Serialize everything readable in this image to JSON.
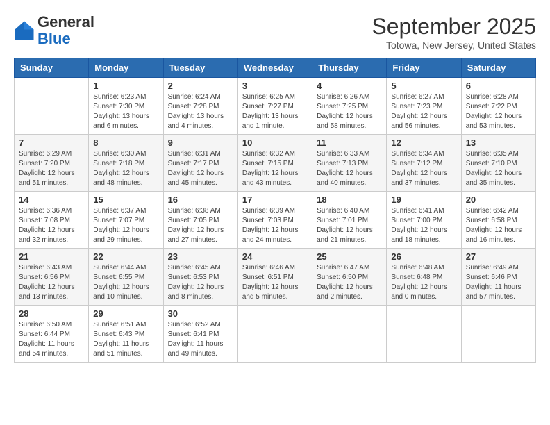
{
  "logo": {
    "general": "General",
    "blue": "Blue"
  },
  "header": {
    "month": "September 2025",
    "location": "Totowa, New Jersey, United States"
  },
  "weekdays": [
    "Sunday",
    "Monday",
    "Tuesday",
    "Wednesday",
    "Thursday",
    "Friday",
    "Saturday"
  ],
  "weeks": [
    [
      {
        "day": "",
        "sunrise": "",
        "sunset": "",
        "daylight": ""
      },
      {
        "day": "1",
        "sunrise": "Sunrise: 6:23 AM",
        "sunset": "Sunset: 7:30 PM",
        "daylight": "Daylight: 13 hours and 6 minutes."
      },
      {
        "day": "2",
        "sunrise": "Sunrise: 6:24 AM",
        "sunset": "Sunset: 7:28 PM",
        "daylight": "Daylight: 13 hours and 4 minutes."
      },
      {
        "day": "3",
        "sunrise": "Sunrise: 6:25 AM",
        "sunset": "Sunset: 7:27 PM",
        "daylight": "Daylight: 13 hours and 1 minute."
      },
      {
        "day": "4",
        "sunrise": "Sunrise: 6:26 AM",
        "sunset": "Sunset: 7:25 PM",
        "daylight": "Daylight: 12 hours and 58 minutes."
      },
      {
        "day": "5",
        "sunrise": "Sunrise: 6:27 AM",
        "sunset": "Sunset: 7:23 PM",
        "daylight": "Daylight: 12 hours and 56 minutes."
      },
      {
        "day": "6",
        "sunrise": "Sunrise: 6:28 AM",
        "sunset": "Sunset: 7:22 PM",
        "daylight": "Daylight: 12 hours and 53 minutes."
      }
    ],
    [
      {
        "day": "7",
        "sunrise": "Sunrise: 6:29 AM",
        "sunset": "Sunset: 7:20 PM",
        "daylight": "Daylight: 12 hours and 51 minutes."
      },
      {
        "day": "8",
        "sunrise": "Sunrise: 6:30 AM",
        "sunset": "Sunset: 7:18 PM",
        "daylight": "Daylight: 12 hours and 48 minutes."
      },
      {
        "day": "9",
        "sunrise": "Sunrise: 6:31 AM",
        "sunset": "Sunset: 7:17 PM",
        "daylight": "Daylight: 12 hours and 45 minutes."
      },
      {
        "day": "10",
        "sunrise": "Sunrise: 6:32 AM",
        "sunset": "Sunset: 7:15 PM",
        "daylight": "Daylight: 12 hours and 43 minutes."
      },
      {
        "day": "11",
        "sunrise": "Sunrise: 6:33 AM",
        "sunset": "Sunset: 7:13 PM",
        "daylight": "Daylight: 12 hours and 40 minutes."
      },
      {
        "day": "12",
        "sunrise": "Sunrise: 6:34 AM",
        "sunset": "Sunset: 7:12 PM",
        "daylight": "Daylight: 12 hours and 37 minutes."
      },
      {
        "day": "13",
        "sunrise": "Sunrise: 6:35 AM",
        "sunset": "Sunset: 7:10 PM",
        "daylight": "Daylight: 12 hours and 35 minutes."
      }
    ],
    [
      {
        "day": "14",
        "sunrise": "Sunrise: 6:36 AM",
        "sunset": "Sunset: 7:08 PM",
        "daylight": "Daylight: 12 hours and 32 minutes."
      },
      {
        "day": "15",
        "sunrise": "Sunrise: 6:37 AM",
        "sunset": "Sunset: 7:07 PM",
        "daylight": "Daylight: 12 hours and 29 minutes."
      },
      {
        "day": "16",
        "sunrise": "Sunrise: 6:38 AM",
        "sunset": "Sunset: 7:05 PM",
        "daylight": "Daylight: 12 hours and 27 minutes."
      },
      {
        "day": "17",
        "sunrise": "Sunrise: 6:39 AM",
        "sunset": "Sunset: 7:03 PM",
        "daylight": "Daylight: 12 hours and 24 minutes."
      },
      {
        "day": "18",
        "sunrise": "Sunrise: 6:40 AM",
        "sunset": "Sunset: 7:01 PM",
        "daylight": "Daylight: 12 hours and 21 minutes."
      },
      {
        "day": "19",
        "sunrise": "Sunrise: 6:41 AM",
        "sunset": "Sunset: 7:00 PM",
        "daylight": "Daylight: 12 hours and 18 minutes."
      },
      {
        "day": "20",
        "sunrise": "Sunrise: 6:42 AM",
        "sunset": "Sunset: 6:58 PM",
        "daylight": "Daylight: 12 hours and 16 minutes."
      }
    ],
    [
      {
        "day": "21",
        "sunrise": "Sunrise: 6:43 AM",
        "sunset": "Sunset: 6:56 PM",
        "daylight": "Daylight: 12 hours and 13 minutes."
      },
      {
        "day": "22",
        "sunrise": "Sunrise: 6:44 AM",
        "sunset": "Sunset: 6:55 PM",
        "daylight": "Daylight: 12 hours and 10 minutes."
      },
      {
        "day": "23",
        "sunrise": "Sunrise: 6:45 AM",
        "sunset": "Sunset: 6:53 PM",
        "daylight": "Daylight: 12 hours and 8 minutes."
      },
      {
        "day": "24",
        "sunrise": "Sunrise: 6:46 AM",
        "sunset": "Sunset: 6:51 PM",
        "daylight": "Daylight: 12 hours and 5 minutes."
      },
      {
        "day": "25",
        "sunrise": "Sunrise: 6:47 AM",
        "sunset": "Sunset: 6:50 PM",
        "daylight": "Daylight: 12 hours and 2 minutes."
      },
      {
        "day": "26",
        "sunrise": "Sunrise: 6:48 AM",
        "sunset": "Sunset: 6:48 PM",
        "daylight": "Daylight: 12 hours and 0 minutes."
      },
      {
        "day": "27",
        "sunrise": "Sunrise: 6:49 AM",
        "sunset": "Sunset: 6:46 PM",
        "daylight": "Daylight: 11 hours and 57 minutes."
      }
    ],
    [
      {
        "day": "28",
        "sunrise": "Sunrise: 6:50 AM",
        "sunset": "Sunset: 6:44 PM",
        "daylight": "Daylight: 11 hours and 54 minutes."
      },
      {
        "day": "29",
        "sunrise": "Sunrise: 6:51 AM",
        "sunset": "Sunset: 6:43 PM",
        "daylight": "Daylight: 11 hours and 51 minutes."
      },
      {
        "day": "30",
        "sunrise": "Sunrise: 6:52 AM",
        "sunset": "Sunset: 6:41 PM",
        "daylight": "Daylight: 11 hours and 49 minutes."
      },
      {
        "day": "",
        "sunrise": "",
        "sunset": "",
        "daylight": ""
      },
      {
        "day": "",
        "sunrise": "",
        "sunset": "",
        "daylight": ""
      },
      {
        "day": "",
        "sunrise": "",
        "sunset": "",
        "daylight": ""
      },
      {
        "day": "",
        "sunrise": "",
        "sunset": "",
        "daylight": ""
      }
    ]
  ]
}
